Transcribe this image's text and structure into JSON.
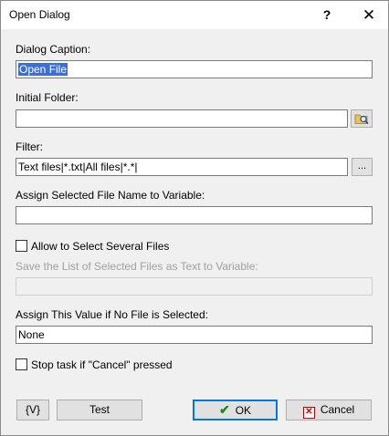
{
  "window": {
    "title": "Open Dialog",
    "help_glyph": "?",
    "close_glyph": "✕"
  },
  "form": {
    "caption_label": "Dialog Caption:",
    "caption_value": "Open File",
    "folder_label": "Initial Folder:",
    "folder_value": "",
    "filter_label": "Filter:",
    "filter_value": "Text files|*.txt|All files|*.*|",
    "filter_browse_label": "...",
    "assign_label": "Assign Selected File Name to Variable:",
    "assign_value": "",
    "allow_several_label": "Allow to Select Several Files",
    "allow_several_checked": false,
    "save_list_label": "Save the List of Selected Files as Text to Variable:",
    "save_list_value": "",
    "no_file_label": "Assign This Value if No File is Selected:",
    "no_file_value": "None",
    "stop_task_label": "Stop task if \"Cancel\" pressed",
    "stop_task_checked": false
  },
  "buttons": {
    "var_label": "{V}",
    "test_label": "Test",
    "ok_label": "OK",
    "cancel_label": "Cancel"
  }
}
